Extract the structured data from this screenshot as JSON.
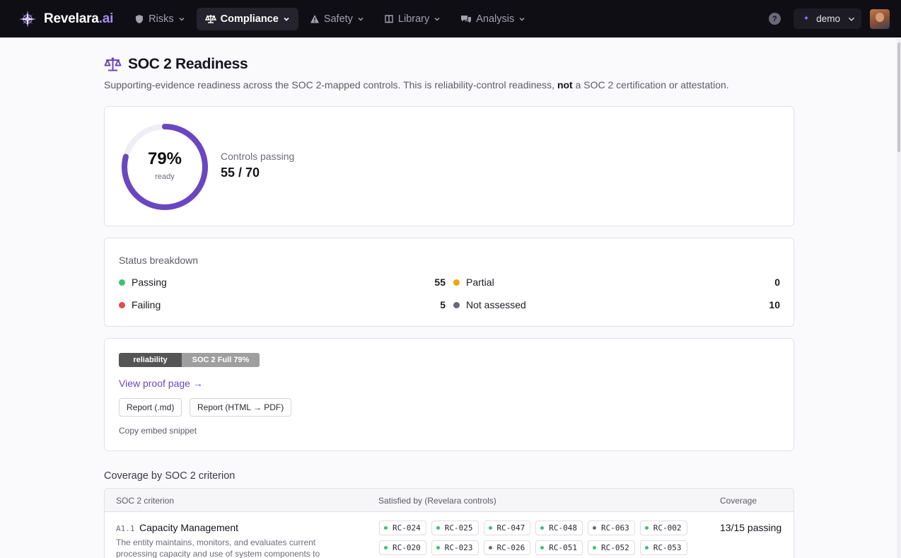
{
  "app": {
    "brand": "Revelara",
    "brand_tld": ".ai",
    "nav": [
      {
        "label": "Risks",
        "icon": "shield-icon"
      },
      {
        "label": "Compliance",
        "icon": "scale-icon",
        "active": true
      },
      {
        "label": "Safety",
        "icon": "warning-icon"
      },
      {
        "label": "Library",
        "icon": "book-icon"
      },
      {
        "label": "Analysis",
        "icon": "chat-icon"
      }
    ],
    "help": "?",
    "user": "demo",
    "accent_color": "#6b46c1"
  },
  "page": {
    "title": "SOC 2 Readiness",
    "subtitle_pre": "Supporting-evidence readiness across the SOC 2-mapped controls. This is reliability-control readiness, ",
    "subtitle_bold": "not",
    "subtitle_post": " a SOC 2 certification or attestation."
  },
  "readiness": {
    "percent": 79,
    "percent_label": "79%",
    "ring_sub": "ready",
    "metric_label": "Controls passing",
    "metric_value": "55 / 70"
  },
  "breakdown": {
    "title": "Status breakdown",
    "items": [
      {
        "label": "Passing",
        "value": "55",
        "color": "#3fbf74"
      },
      {
        "label": "Partial",
        "value": "0",
        "color": "#f0a30a"
      },
      {
        "label": "Failing",
        "value": "5",
        "color": "#e5484d"
      },
      {
        "label": "Not assessed",
        "value": "10",
        "color": "#6b6976"
      }
    ]
  },
  "badge_section": {
    "badge_left": "reliability",
    "badge_right": "SOC 2 Full 79%",
    "proof_link": "View proof page →",
    "buttons": [
      "Report (.md)",
      "Report (HTML → PDF)"
    ],
    "embed": "Copy embed snippet"
  },
  "coverage": {
    "title": "Coverage by SOC 2 criterion",
    "headers": [
      "SOC 2 criterion",
      "Satisfied by (Revelara controls)",
      "Coverage"
    ],
    "rows": [
      {
        "code": "A1.1",
        "name": "Capacity Management",
        "description": "The entity maintains, monitors, and evaluates current processing capacity and use of system components to",
        "coverage": "13/15 passing",
        "controls": [
          {
            "id": "RC-024",
            "status": "passing"
          },
          {
            "id": "RC-025",
            "status": "passing"
          },
          {
            "id": "RC-047",
            "status": "passing"
          },
          {
            "id": "RC-048",
            "status": "passing"
          },
          {
            "id": "RC-063",
            "status": "not-assessed"
          },
          {
            "id": "RC-002",
            "status": "passing"
          },
          {
            "id": "RC-020",
            "status": "passing"
          },
          {
            "id": "RC-023",
            "status": "passing"
          },
          {
            "id": "RC-026",
            "status": "not-assessed"
          },
          {
            "id": "RC-051",
            "status": "passing"
          },
          {
            "id": "RC-052",
            "status": "passing"
          },
          {
            "id": "RC-053",
            "status": "passing"
          }
        ]
      }
    ]
  }
}
